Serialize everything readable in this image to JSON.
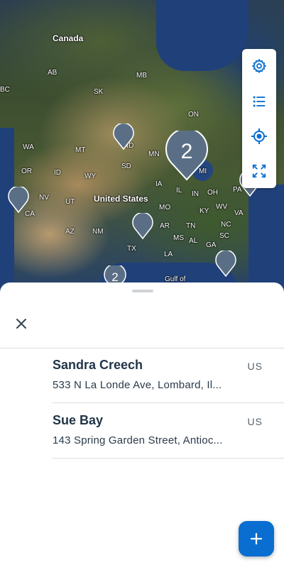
{
  "map": {
    "labels": {
      "canada": "Canada",
      "united_states": "United States",
      "gulf": "Gulf of",
      "ab": "AB",
      "mb": "MB",
      "sk": "SK",
      "bc": "BC",
      "on": "ON",
      "wa": "WA",
      "mt": "MT",
      "nd": "ND",
      "mn": "MN",
      "mi": "MI",
      "or": "OR",
      "id": "ID",
      "wy": "WY",
      "sd": "SD",
      "ia": "IA",
      "il": "IL",
      "in": "IN",
      "oh": "OH",
      "pa": "PA",
      "nv": "NV",
      "ut": "UT",
      "ca": "CA",
      "mo": "MO",
      "ky": "KY",
      "wv": "WV",
      "va": "VA",
      "az": "AZ",
      "nm": "NM",
      "ar": "AR",
      "tn": "TN",
      "nc": "NC",
      "sc": "SC",
      "ms": "MS",
      "al": "AL",
      "ga": "GA",
      "tx": "TX",
      "la": "LA"
    },
    "cluster_count": "2",
    "small_cluster_count": "2"
  },
  "toolbar": {
    "settings_icon": "gear-icon",
    "list_icon": "list-icon",
    "locate_icon": "locate-icon",
    "fit_icon": "expand-icon",
    "accent": "#0a6ed1"
  },
  "sheet": {
    "close_icon": "close-icon",
    "items": [
      {
        "name": "Sandra Creech",
        "address": "533 N La Londe Ave, Lombard, Il...",
        "country": "US"
      },
      {
        "name": "Sue Bay",
        "address": "143 Spring Garden Street, Antioc...",
        "country": "US"
      }
    ]
  },
  "fab": {
    "icon": "plus-icon"
  }
}
